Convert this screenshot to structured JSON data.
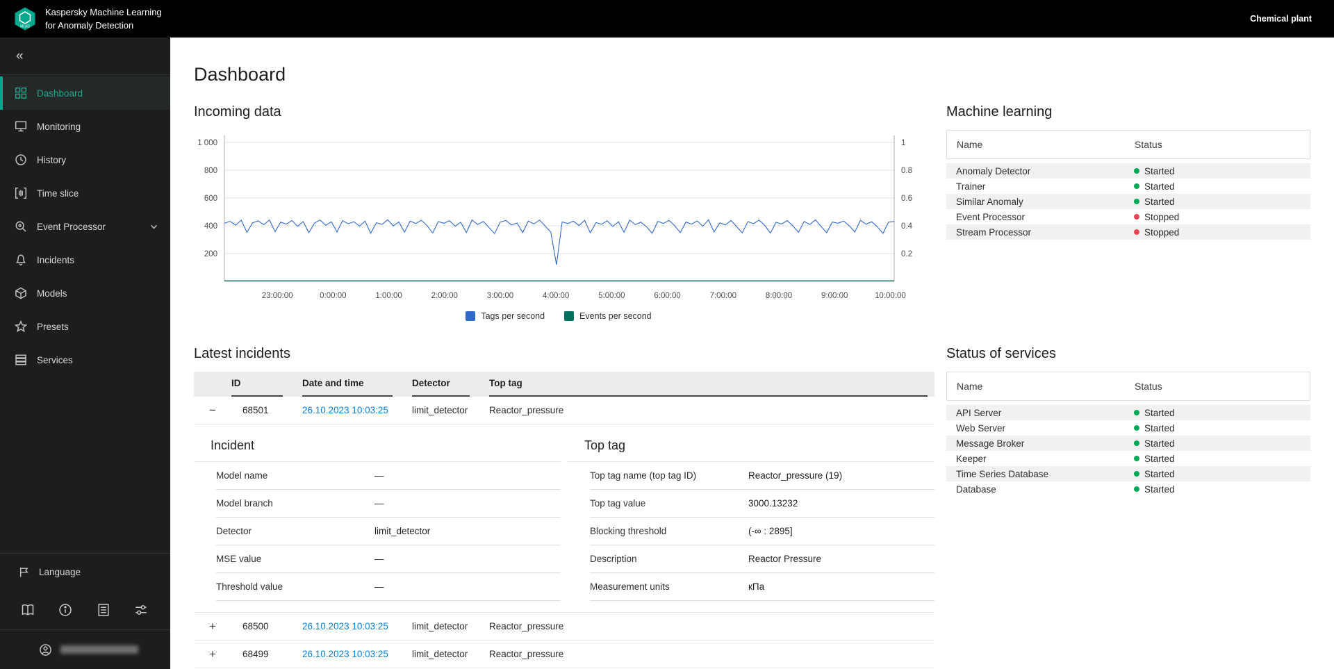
{
  "colors": {
    "accent_green": "#00a88e",
    "status_started": "#00a956",
    "status_stopped": "#e84855",
    "link_blue": "#0e80d7",
    "tags_line": "#3169cb",
    "events_line": "#00715f"
  },
  "topbar": {
    "app_title_line1": "Kaspersky Machine Learning",
    "app_title_line2": "for Anomaly Detection",
    "tenant": "Chemical plant"
  },
  "sidebar": {
    "collapse_glyph": "«",
    "items": [
      {
        "label": "Dashboard"
      },
      {
        "label": "Monitoring"
      },
      {
        "label": "History"
      },
      {
        "label": "Time slice"
      },
      {
        "label": "Event Processor"
      },
      {
        "label": "Incidents"
      },
      {
        "label": "Models"
      },
      {
        "label": "Presets"
      },
      {
        "label": "Services"
      }
    ],
    "language_label": "Language"
  },
  "page": {
    "title": "Dashboard"
  },
  "incoming": {
    "heading": "Incoming data"
  },
  "chart_data": {
    "type": "line",
    "title": "Incoming data",
    "x_tick_labels": [
      "23:00:00",
      "0:00:00",
      "1:00:00",
      "2:00:00",
      "3:00:00",
      "4:00:00",
      "5:00:00",
      "6:00:00",
      "7:00:00",
      "8:00:00",
      "9:00:00",
      "10:00:00"
    ],
    "y_left": {
      "ticks": [
        "200",
        "400",
        "600",
        "800",
        "1 000"
      ],
      "tick_values": [
        200,
        400,
        600,
        800,
        1000
      ],
      "range": [
        0,
        1050
      ]
    },
    "y_right": {
      "ticks": [
        "0.2",
        "0.4",
        "0.6",
        "0.8",
        "1"
      ],
      "tick_values": [
        0.2,
        0.4,
        0.6,
        0.8,
        1
      ],
      "range": [
        0,
        1
      ]
    },
    "grid": true,
    "legend_position": "bottom",
    "series": [
      {
        "name": "Tags per second",
        "color": "#3169cb",
        "axis": "left",
        "values": [
          418,
          432,
          405,
          440,
          352,
          421,
          435,
          408,
          442,
          358,
          426,
          412,
          438,
          396,
          430,
          350,
          419,
          441,
          404,
          428,
          356,
          437,
          414,
          429,
          398,
          433,
          346,
          422,
          410,
          443,
          400,
          427,
          354,
          434,
          416,
          440,
          402,
          348,
          430,
          418,
          436,
          397,
          425,
          352,
          442,
          409,
          431,
          388,
          344,
          426,
          439,
          406,
          420,
          351,
          434,
          413,
          441,
          398,
          354,
          120,
          428,
          416,
          433,
          402,
          439,
          349,
          423,
          411,
          436,
          395,
          429,
          353,
          441,
          408,
          426,
          392,
          346,
          432,
          417,
          439,
          400,
          351,
          427,
          412,
          435,
          397,
          443,
          356,
          421,
          406,
          438,
          394,
          349,
          430,
          415,
          441,
          403,
          347,
          425,
          413,
          437,
          399,
          353,
          431,
          409,
          443,
          396,
          350,
          427,
          418,
          434,
          401,
          355,
          439,
          411,
          429,
          393,
          345,
          426,
          431
        ]
      },
      {
        "name": "Events per second",
        "color": "#00715f",
        "axis": "right",
        "constant_value": 0
      }
    ]
  },
  "machine_learning": {
    "heading": "Machine learning",
    "columns": {
      "name": "Name",
      "status": "Status"
    },
    "rows": [
      {
        "name": "Anomaly Detector",
        "status": "Started"
      },
      {
        "name": "Trainer",
        "status": "Started"
      },
      {
        "name": "Similar Anomaly",
        "status": "Started"
      },
      {
        "name": "Event Processor",
        "status": "Stopped"
      },
      {
        "name": "Stream Processor",
        "status": "Stopped"
      }
    ]
  },
  "incidents": {
    "heading": "Latest incidents",
    "columns": {
      "id": "ID",
      "date": "Date and time",
      "detector": "Detector",
      "top_tag": "Top tag"
    },
    "rows": [
      {
        "expand": "−",
        "id": "68501",
        "date": "26.10.2023 10:03:25",
        "detector": "limit_detector",
        "top_tag": "Reactor_pressure"
      },
      {
        "expand": "+",
        "id": "68500",
        "date": "26.10.2023 10:03:25",
        "detector": "limit_detector",
        "top_tag": "Reactor_pressure"
      },
      {
        "expand": "+",
        "id": "68499",
        "date": "26.10.2023 10:03:25",
        "detector": "limit_detector",
        "top_tag": "Reactor_pressure"
      }
    ],
    "detail": {
      "incident_panel": {
        "title": "Incident",
        "rows": [
          {
            "label": "Model name",
            "value": "—"
          },
          {
            "label": "Model branch",
            "value": "—"
          },
          {
            "label": "Detector",
            "value": "limit_detector"
          },
          {
            "label": "MSE value",
            "value": "—"
          },
          {
            "label": "Threshold value",
            "value": "—"
          }
        ]
      },
      "top_tag_panel": {
        "title": "Top tag",
        "rows": [
          {
            "label": "Top tag name (top tag ID)",
            "value": "Reactor_pressure (19)"
          },
          {
            "label": "Top tag value",
            "value": "3000.13232"
          },
          {
            "label": "Blocking threshold",
            "value": "(-∞ : 2895]"
          },
          {
            "label": "Description",
            "value": "Reactor Pressure"
          },
          {
            "label": "Measurement units",
            "value": "кПа"
          }
        ]
      }
    }
  },
  "services": {
    "heading": "Status of services",
    "columns": {
      "name": "Name",
      "status": "Status"
    },
    "rows": [
      {
        "name": "API Server",
        "status": "Started"
      },
      {
        "name": "Web Server",
        "status": "Started"
      },
      {
        "name": "Message Broker",
        "status": "Started"
      },
      {
        "name": "Keeper",
        "status": "Started"
      },
      {
        "name": "Time Series Database",
        "status": "Started"
      },
      {
        "name": "Database",
        "status": "Started"
      }
    ]
  }
}
